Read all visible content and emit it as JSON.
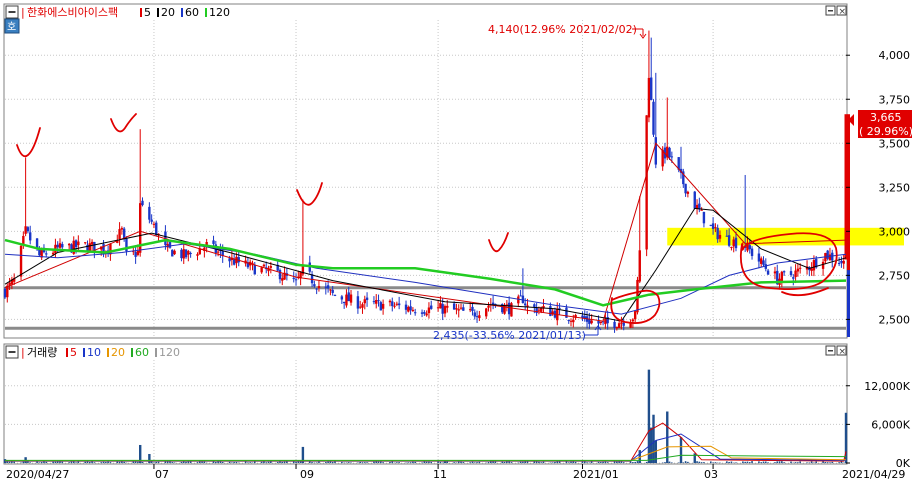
{
  "colors": {
    "bg": "#ffffff",
    "grid": "#c8c8c8",
    "frame": "#808080",
    "up": "#e00000",
    "down": "#1a36c8",
    "ma5": "#d00000",
    "ma20": "#000000",
    "ma60": "#2030c0",
    "ma120": "#22cc22",
    "highlight": "#ffff00",
    "ink": "#e00000",
    "support": "#8a8a8a"
  },
  "price_panel": {
    "legend": {
      "prefix": "|",
      "title": "한화에스비아이스팩",
      "items": [
        {
          "label": "5",
          "color": "#e00000"
        },
        {
          "label": "20",
          "color": "#000000"
        },
        {
          "label": "60",
          "color": "#1a36c8"
        },
        {
          "label": "120",
          "color": "#22cc22"
        }
      ]
    },
    "max_annotation": "4,140(12.96% 2021/02/02)",
    "min_annotation": "2,435(-33.56% 2021/01/13)",
    "current_price": "3,665",
    "current_change": "( 29.96%)",
    "y_ticks": [
      "2,500",
      "2,750",
      "3,000",
      "3,250",
      "3,500",
      "3,750",
      "4,000"
    ]
  },
  "volume_panel": {
    "legend": {
      "title": "거래량",
      "items": [
        {
          "label": "5",
          "color": "#e00000"
        },
        {
          "label": "10",
          "color": "#1a36c8"
        },
        {
          "label": "20",
          "color": "#e69500"
        },
        {
          "label": "60",
          "color": "#22aa22"
        },
        {
          "label": "120",
          "color": "#999999"
        }
      ]
    },
    "y_ticks": [
      "0K",
      "6,000K",
      "12,000K"
    ]
  },
  "x_axis": {
    "labels": [
      "2020/04/27",
      "07",
      "09",
      "11",
      "2021/01",
      "03"
    ],
    "end_label": "2021/04/29"
  },
  "chart_data": [
    {
      "type": "candlestick",
      "title": "한화에스비아이스팩",
      "x_range": [
        "2020/04/27",
        "2021/04/29"
      ],
      "ylim": [
        2400,
        4200
      ],
      "y_ticks": [
        2500,
        2750,
        3000,
        3250,
        3500,
        3750,
        4000
      ],
      "max": {
        "value": 4140,
        "change_pct": 12.96,
        "date": "2021/02/02"
      },
      "min": {
        "value": 2435,
        "change_pct": -33.56,
        "date": "2021/01/13"
      },
      "last": {
        "value": 3665,
        "change_pct": 29.96,
        "date": "2021/04/29"
      },
      "close_path": [
        [
          "2020/04/27",
          2660
        ],
        [
          "2020/05/01",
          2720
        ],
        [
          "2020/05/06",
          3000
        ],
        [
          "2020/05/12",
          2860
        ],
        [
          "2020/05/20",
          2900
        ],
        [
          "2020/06/01",
          2920
        ],
        [
          "2020/06/10",
          2900
        ],
        [
          "2020/06/17",
          3000
        ],
        [
          "2020/06/19",
          2860
        ],
        [
          "2020/06/24",
          2880
        ],
        [
          "2020/06/25",
          3150
        ],
        [
          "2020/06/30",
          3050
        ],
        [
          "2020/07/06",
          2900
        ],
        [
          "2020/07/15",
          2860
        ],
        [
          "2020/07/24",
          2920
        ],
        [
          "2020/08/03",
          2840
        ],
        [
          "2020/08/14",
          2790
        ],
        [
          "2020/08/25",
          2760
        ],
        [
          "2020/09/01",
          2700
        ],
        [
          "2020/09/04",
          2780
        ],
        [
          "2020/09/10",
          2700
        ],
        [
          "2020/09/17",
          2640
        ],
        [
          "2020/09/29",
          2590
        ],
        [
          "2020/10/12",
          2580
        ],
        [
          "2020/10/23",
          2560
        ],
        [
          "2020/11/05",
          2560
        ],
        [
          "2020/11/17",
          2530
        ],
        [
          "2020/11/25",
          2590
        ],
        [
          "2020/12/04",
          2560
        ],
        [
          "2020/12/09",
          2620
        ],
        [
          "2020/12/11",
          2570
        ],
        [
          "2020/12/23",
          2540
        ],
        [
          "2021/01/05",
          2500
        ],
        [
          "2021/01/13",
          2470
        ],
        [
          "2021/01/21",
          2490
        ],
        [
          "2021/01/27",
          2520
        ],
        [
          "2021/01/29",
          2900
        ],
        [
          "2021/02/02",
          3900
        ],
        [
          "2021/02/05",
          3400
        ],
        [
          "2021/02/10",
          3450
        ],
        [
          "2021/02/16",
          3300
        ],
        [
          "2021/02/22",
          3150
        ],
        [
          "2021/03/02",
          3000
        ],
        [
          "2021/03/09",
          2950
        ],
        [
          "2021/03/16",
          2920
        ],
        [
          "2021/03/23",
          2820
        ],
        [
          "2021/03/30",
          2730
        ],
        [
          "2021/04/06",
          2760
        ],
        [
          "2021/04/13",
          2800
        ],
        [
          "2021/04/20",
          2870
        ],
        [
          "2021/04/27",
          2830
        ],
        [
          "2021/04/28",
          2820
        ],
        [
          "2021/04/29",
          3665
        ]
      ],
      "moving_averages": [
        {
          "name": "5",
          "path": [
            [
              "2020/04/27",
              2680
            ],
            [
              "2020/06/25",
              3000
            ],
            [
              "2020/09/01",
              2740
            ],
            [
              "2021/01/13",
              2490
            ],
            [
              "2021/02/05",
              3500
            ],
            [
              "2021/03/16",
              2930
            ],
            [
              "2021/04/29",
              2950
            ]
          ]
        },
        {
          "name": "20",
          "path": [
            [
              "2020/04/27",
              2700
            ],
            [
              "2020/05/20",
              2880
            ],
            [
              "2020/06/30",
              2990
            ],
            [
              "2020/08/03",
              2880
            ],
            [
              "2020/09/17",
              2720
            ],
            [
              "2020/11/05",
              2600
            ],
            [
              "2020/12/23",
              2560
            ],
            [
              "2021/01/21",
              2490
            ],
            [
              "2021/02/05",
              2780
            ],
            [
              "2021/02/22",
              3130
            ],
            [
              "2021/03/02",
              3120
            ],
            [
              "2021/03/23",
              2900
            ],
            [
              "2021/04/13",
              2790
            ],
            [
              "2021/04/29",
              2850
            ]
          ]
        },
        {
          "name": "60",
          "path": [
            [
              "2020/04/27",
              2870
            ],
            [
              "2020/05/20",
              2850
            ],
            [
              "2020/06/17",
              2880
            ],
            [
              "2020/07/15",
              2930
            ],
            [
              "2020/08/14",
              2870
            ],
            [
              "2020/09/10",
              2790
            ],
            [
              "2020/10/23",
              2710
            ],
            [
              "2020/11/25",
              2640
            ],
            [
              "2020/12/23",
              2580
            ],
            [
              "2021/01/21",
              2530
            ],
            [
              "2021/02/16",
              2620
            ],
            [
              "2021/03/09",
              2750
            ],
            [
              "2021/03/30",
              2820
            ],
            [
              "2021/04/29",
              2870
            ]
          ]
        },
        {
          "name": "120",
          "path": [
            [
              "2020/04/27",
              2950
            ],
            [
              "2020/05/12",
              2900
            ],
            [
              "2020/06/10",
              2880
            ],
            [
              "2020/07/06",
              2950
            ],
            [
              "2020/08/03",
              2900
            ],
            [
              "2020/09/01",
              2810
            ],
            [
              "2020/09/17",
              2790
            ],
            [
              "2020/10/23",
              2790
            ],
            [
              "2020/11/25",
              2730
            ],
            [
              "2020/12/23",
              2670
            ],
            [
              "2021/01/13",
              2580
            ],
            [
              "2021/02/02",
              2640
            ],
            [
              "2021/02/22",
              2670
            ],
            [
              "2021/03/23",
              2710
            ],
            [
              "2021/04/29",
              2720
            ]
          ]
        }
      ],
      "support_lines": [
        2680,
        2450
      ],
      "highlight_band": [
        2920,
        3020
      ]
    },
    {
      "type": "bar",
      "title": "거래량",
      "ylim": [
        0,
        16000
      ],
      "y_ticks": [
        0,
        6000,
        12000
      ],
      "unit": "K",
      "bars": [
        [
          "2020/04/27",
          600
        ],
        [
          "2020/05/06",
          900
        ],
        [
          "2020/06/25",
          2800
        ],
        [
          "2020/06/29",
          1400
        ],
        [
          "2020/09/04",
          2500
        ],
        [
          "2020/11/05",
          300
        ],
        [
          "2021/01/29",
          2000
        ],
        [
          "2021/02/02",
          14500
        ],
        [
          "2021/02/03",
          5500
        ],
        [
          "2021/02/04",
          7500
        ],
        [
          "2021/02/05",
          3500
        ],
        [
          "2021/02/10",
          8000
        ],
        [
          "2021/02/16",
          4000
        ],
        [
          "2021/02/22",
          1500
        ],
        [
          "2021/04/29",
          7800
        ]
      ]
    }
  ]
}
